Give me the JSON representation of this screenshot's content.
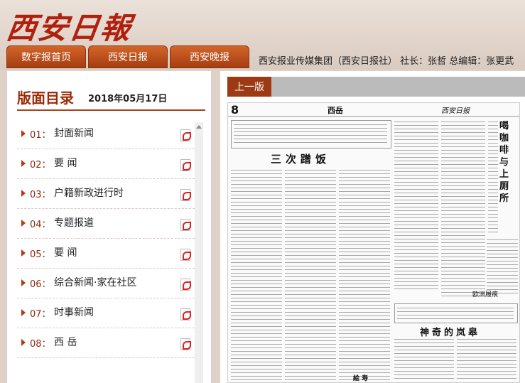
{
  "header": {
    "logo": "西安日報",
    "nav": [
      "数字报首页",
      "西安日报",
      "西安晚报"
    ],
    "credits": "西安报业传媒集团（西安日报社） 社长：张哲 总编辑：张更武"
  },
  "directory": {
    "title": "版面目录",
    "date": "2018年05月17日",
    "items": [
      {
        "num": "01：",
        "name": "封面新闻"
      },
      {
        "num": "02：",
        "name": "要 闻"
      },
      {
        "num": "03：",
        "name": "户籍新政进行时"
      },
      {
        "num": "04：",
        "name": "专题报道"
      },
      {
        "num": "05：",
        "name": "要 闻"
      },
      {
        "num": "06：",
        "name": "综合新闻·家在社区"
      },
      {
        "num": "07：",
        "name": "时事新闻"
      },
      {
        "num": "08：",
        "name": "西 岳"
      }
    ]
  },
  "viewer": {
    "prev_label": "上一版",
    "page_num": "8",
    "section": "西岳",
    "brand": "西安日报",
    "headline1": "三次蹭饭",
    "headline2": "喝咖啡与上厕所",
    "headline3": "神奇的岚皋",
    "tag1": "欧洲履痕",
    "tag2": "絵 寿"
  },
  "colors": {
    "accent": "#9d3913",
    "nav_bg": "#c4541d",
    "logo_red": "#b0200d"
  }
}
